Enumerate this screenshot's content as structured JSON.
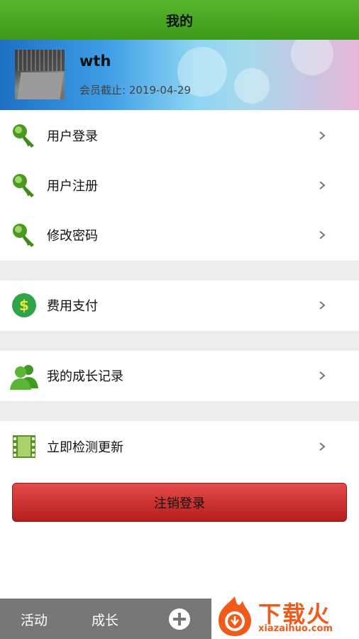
{
  "header": {
    "title": "我的"
  },
  "profile": {
    "username": "wth",
    "expiry": "会员截止: 2019-04-29"
  },
  "menu": [
    {
      "label": "用户登录",
      "icon": "key-icon"
    },
    {
      "label": "用户注册",
      "icon": "key-icon"
    },
    {
      "label": "修改密码",
      "icon": "key-icon"
    },
    {
      "label": "费用支付",
      "icon": "dollar-icon"
    },
    {
      "label": "我的成长记录",
      "icon": "users-icon"
    },
    {
      "label": "立即检测更新",
      "icon": "film-icon"
    }
  ],
  "logout_label": "注销登录",
  "tabbar": {
    "tab1": "活动",
    "tab2": "成长"
  },
  "watermark": {
    "text": "下载火",
    "url": "xiazaihuo.com"
  },
  "colors": {
    "header": "#4aa823",
    "logout": "#c9302c",
    "tabbar": "#777777"
  }
}
